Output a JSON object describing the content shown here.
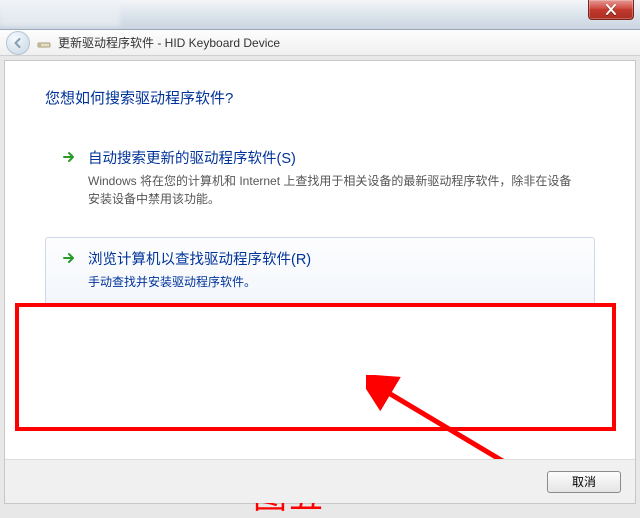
{
  "window": {
    "title_prefix": "更新驱动程序软件 - ",
    "title_device": "HID Keyboard Device"
  },
  "dialog": {
    "heading": "您想如何搜索驱动程序软件?",
    "options": [
      {
        "title": "自动搜索更新的驱动程序软件(S)",
        "desc": "Windows 将在您的计算机和 Internet 上查找用于相关设备的最新驱动程序软件，除非在设备安装设备中禁用该功能。"
      },
      {
        "title": "浏览计算机以查找驱动程序软件(R)",
        "desc": "手动查找并安装驱动程序软件。"
      }
    ],
    "cancel": "取消"
  },
  "annotation": {
    "caption": "图五"
  }
}
